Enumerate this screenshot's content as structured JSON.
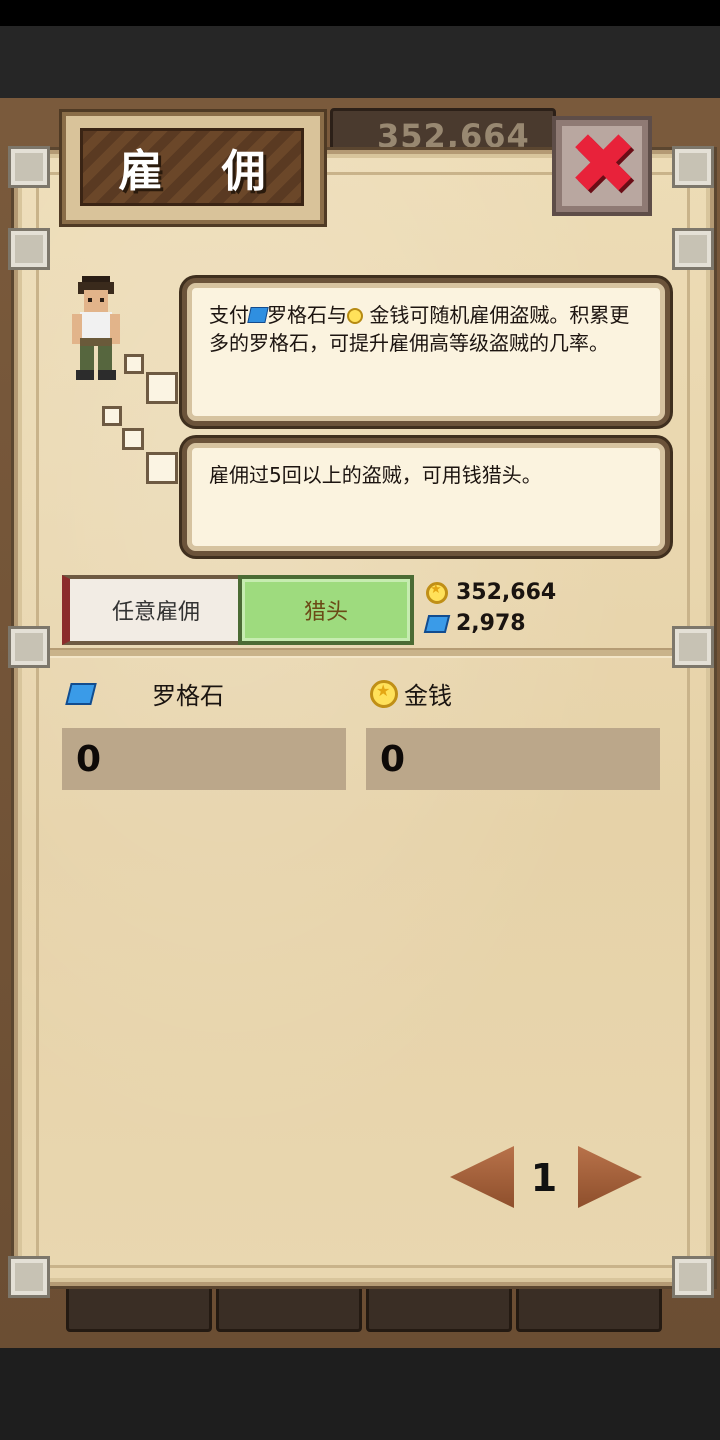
{
  "top_bar": {
    "coins": "352,664"
  },
  "dialog": {
    "title": "雇 佣",
    "close_icon": "close-icon",
    "speech_1": {
      "part_a": "支付",
      "part_b": "罗格石与",
      "part_c": " 金钱可随机雇佣盗贼。积累更多的罗格石，可提升雇佣高等级盗贼的几率。"
    },
    "speech_2": "雇佣过5回以上的盗贼，可用钱猎头。",
    "tabs": [
      {
        "label": "任意雇佣",
        "active": false
      },
      {
        "label": "猎头",
        "active": true
      }
    ],
    "balance": {
      "coins": "352,664",
      "gems": "2,978"
    },
    "cost": {
      "gem_label": "罗格石",
      "gem_value": "0",
      "coin_label": "金钱",
      "coin_value": "0"
    },
    "pager": {
      "page": "1"
    }
  },
  "colors": {
    "parchment": "#e9d7b0",
    "active_tab": "#9edb7e",
    "close_red": "#e8223a",
    "gem_blue": "#3a9be8",
    "coin_gold": "#ffe15a"
  }
}
